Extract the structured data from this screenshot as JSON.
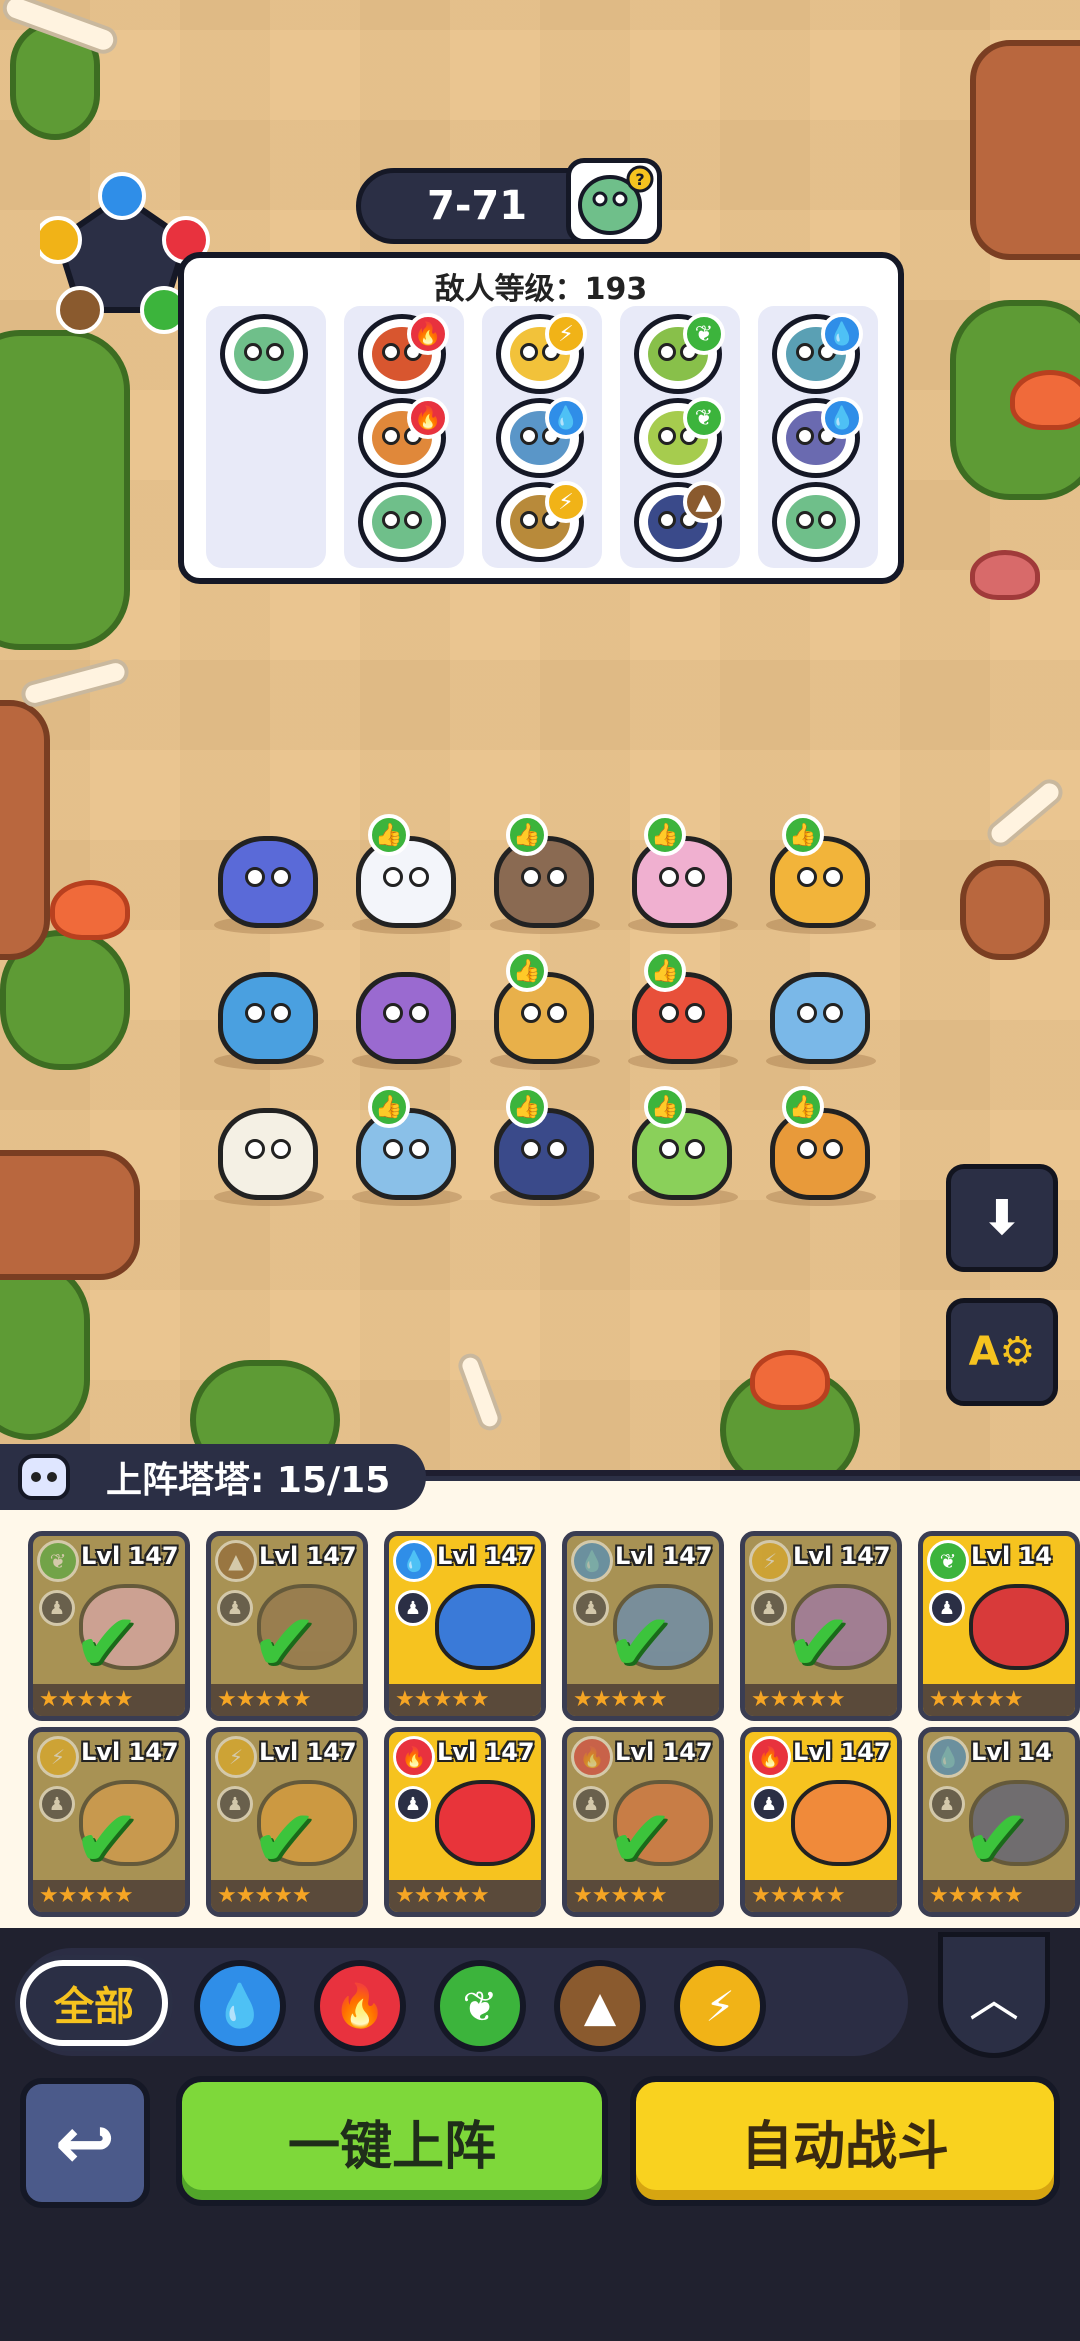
{
  "stage": {
    "label": "7-71"
  },
  "enemy_panel": {
    "level_label": "敌人等级：193",
    "columns": [
      {
        "enemies": [
          {
            "element": "none",
            "color": "#6fbf8a"
          }
        ]
      },
      {
        "enemies": [
          {
            "element": "fire",
            "color": "#d8562f"
          },
          {
            "element": "fire",
            "color": "#e0883a"
          },
          {
            "element": "none",
            "color": "#6fbf8a"
          }
        ]
      },
      {
        "enemies": [
          {
            "element": "thunder",
            "color": "#f2c23a"
          },
          {
            "element": "water",
            "color": "#5a96c8"
          },
          {
            "element": "thunder",
            "color": "#b88a3a"
          }
        ]
      },
      {
        "enemies": [
          {
            "element": "grass",
            "color": "#88c04a"
          },
          {
            "element": "grass",
            "color": "#a6cc4e"
          },
          {
            "element": "earth",
            "color": "#3a4a8a"
          }
        ]
      },
      {
        "enemies": [
          {
            "element": "water",
            "color": "#5aa0b4"
          },
          {
            "element": "water",
            "color": "#6a6ab0"
          },
          {
            "element": "none",
            "color": "#6fbf8a"
          }
        ]
      }
    ]
  },
  "icons": {
    "water": "💧",
    "fire": "🔥",
    "grass": "❦",
    "earth": "▲",
    "thunder": "⚡",
    "thumbs_up": "👍",
    "download": "⬇",
    "auto_settings": "A⚙",
    "check": "✔",
    "collapse": "︿",
    "back": "↩",
    "role": "♟"
  },
  "roster": {
    "title": "上阵塔塔: 15/15",
    "cards": [
      {
        "lvl": "Lvl 147",
        "element": "grass",
        "selected": true,
        "pet_color": "#f0b0d0",
        "stars": "★★★★★"
      },
      {
        "lvl": "Lvl 147",
        "element": "earth",
        "selected": true,
        "pet_color": "#8a6a4a",
        "stars": "★★★★★"
      },
      {
        "lvl": "Lvl 147",
        "element": "water",
        "selected": false,
        "pet_color": "#3a7ad8",
        "stars": "★★★★★"
      },
      {
        "lvl": "Lvl 147",
        "element": "water",
        "selected": true,
        "pet_color": "#4a8ae0",
        "stars": "★★★★★"
      },
      {
        "lvl": "Lvl 147",
        "element": "thunder",
        "selected": true,
        "pet_color": "#9a6ad0",
        "stars": "★★★★★"
      },
      {
        "lvl": "Lvl 14",
        "element": "grass",
        "selected": false,
        "pet_color": "#d83a3a",
        "stars": "★★★★★"
      },
      {
        "lvl": "Lvl 147",
        "element": "thunder",
        "selected": true,
        "pet_color": "#e8a04a",
        "stars": "★★★★★"
      },
      {
        "lvl": "Lvl 147",
        "element": "thunder",
        "selected": true,
        "pet_color": "#f0a030",
        "stars": "★★★★★"
      },
      {
        "lvl": "Lvl 147",
        "element": "fire",
        "selected": false,
        "pet_color": "#e8343a",
        "stars": "★★★★★"
      },
      {
        "lvl": "Lvl 147",
        "element": "fire",
        "selected": true,
        "pet_color": "#e86a3a",
        "stars": "★★★★★"
      },
      {
        "lvl": "Lvl 147",
        "element": "fire",
        "selected": false,
        "pet_color": "#f08a3a",
        "stars": "★★★★★"
      },
      {
        "lvl": "Lvl 14",
        "element": "water",
        "selected": true,
        "pet_color": "#3a4a8a",
        "stars": "★★★★★"
      }
    ]
  },
  "filters": {
    "all_label": "全部",
    "elements": [
      "water",
      "fire",
      "grass",
      "earth",
      "thunder"
    ]
  },
  "buttons": {
    "deploy_label": "一键上阵",
    "auto_battle_label": "自动战斗"
  },
  "colors": {
    "water": "#2f8ee8",
    "fire": "#e8323e",
    "grass": "#3cb43c",
    "earth": "#8a5a2e",
    "thunder": "#f1b317",
    "deploy": "#7ed83a",
    "auto": "#f9d21f"
  },
  "field_heroes": [
    {
      "color": "#5a6ad8",
      "thumb": false
    },
    {
      "color": "#f3f5fa",
      "thumb": true
    },
    {
      "color": "#8a6a52",
      "thumb": true
    },
    {
      "color": "#f0b0d0",
      "thumb": true
    },
    {
      "color": "#f2b43a",
      "thumb": true
    },
    {
      "color": "#4aa0e0",
      "thumb": false
    },
    {
      "color": "#9a6ad0",
      "thumb": false
    },
    {
      "color": "#e8b04a",
      "thumb": true
    },
    {
      "color": "#e8503a",
      "thumb": true
    },
    {
      "color": "#7ab8e8",
      "thumb": false
    },
    {
      "color": "#f4f0e4",
      "thumb": false
    },
    {
      "color": "#8ac0e8",
      "thumb": true
    },
    {
      "color": "#3a4a8a",
      "thumb": true
    },
    {
      "color": "#8ad05a",
      "thumb": true
    },
    {
      "color": "#e89a3a",
      "thumb": true
    }
  ]
}
